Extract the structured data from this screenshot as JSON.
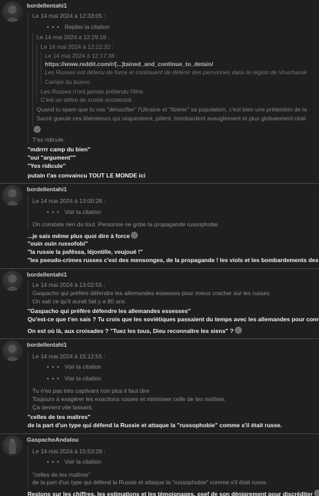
{
  "posts": [
    {
      "author": "bordellentahi1",
      "q_date_1": "Le 14 mai 2024 à 12:33:05 :",
      "q_reply": "Replier la citation",
      "q_date_2": "Le 14 mai 2024 à 12:29:16 :",
      "q_date_3": "Le 14 mai 2024 à 12:22:32 :",
      "q_date_4": "Le 14 mai 2024 à 12:17:38 :",
      "q_link": "https://www.reddit.com/r/[...]tained_and_continue_to_detain/",
      "q_italic": "Les Russes ont détenu de force et continuent de détenir des personnes dans la région de Vovchansk",
      "q_campo": "Campo du bueno",
      "q_l3a": "Les Russes n'ont jamais prétendu l'être.",
      "q_l3b": "C'est un délire de croisé occidental.",
      "q_l2a": "Quand tu spam que tu vas \"dénazifier\" l'Ukraine et \"libérer\" sa population, c'est bien une prétention de la",
      "q_l2b": "Sacré gueule ces libérateurs qui séquestrent, pillent, bombardent aveuglément et plus globalement réali",
      "q_l1": "T'es ridicule.",
      "body": [
        "\"mdrrrr camp du bien\"",
        "\"oui \"argument\"\"",
        "\"Yes ridicule\"",
        "putain t'as convaincu TOUT LE MONDE ici"
      ]
    },
    {
      "author": "bordellentahi1",
      "q_date": "Le 14 mai 2024 à 13:00:28 :",
      "q_see": "Voir la citation",
      "q_l1": "On constate rien du tout. Personne ne gobe ta propagande russophobe.",
      "body": [
        "...je sais même plus quoi dire à force",
        "\"ouin ouin russofobi\"",
        "\"la russie la pafêssa, léjontille, veujoué !\"",
        "\"les pseudo-crimes russes c'est des mensonges, de la propagande ! les viols et les bombardements des Gl"
      ]
    },
    {
      "author": "bordellentahi1",
      "q_date": "Le 14 mai 2024 à 13:02:55 :",
      "q_l1a": "Gaspacho qui préfère défendre les allemandes essesses pour mieux cracher sur les russes",
      "q_l1b": "On sait ce qu'il aurait fait y a 80 ans.",
      "body": [
        "\"Gaspacho qui préfère défendre les allemandes essesses\"",
        "Qu'est-ce que t'en sais ? Tu crois que les soviétiques passaient du temps avec les allemandes pour connaît",
        "On est où là, aux croisades ? \"Tuez les tous, Dieu reconnaître les siens\" ?"
      ]
    },
    {
      "author": "bordellentahi1",
      "q_date": "Le 14 mai 2024 à 15:12:55 :",
      "q_see": "Voir la citation",
      "q_see2": "Voir la citation",
      "q_l1a": "Tu n'es pas très captivant non plus il faut dire",
      "q_l1b": "Toujours à exagérer les exactions russes et minimiser celle de tes maîtres.",
      "q_l1c": "Ça devient vite lassant.",
      "body": [
        "\"celles de tes maîtres\"",
        "de la part d'un type qui défend la Russie et attaque la \"russophobie\" comme s'il était russe."
      ]
    },
    {
      "author": "GaspachoAndalou",
      "q_date": "Le 14 mai 2024 à 15:53:29 :",
      "q_see": "Voir la citation",
      "q_l1a": "\"celles de tes maîtres\"",
      "q_l1b": "de la part d'un type qui défend la Russie et attaque la \"russophobie\" comme s'il était russe.",
      "body": [
        "Restons sur les chiffres, les estimations et les témoignages, osef de son dénigrement pour discréditer"
      ]
    }
  ],
  "ellipsis": "• • •"
}
